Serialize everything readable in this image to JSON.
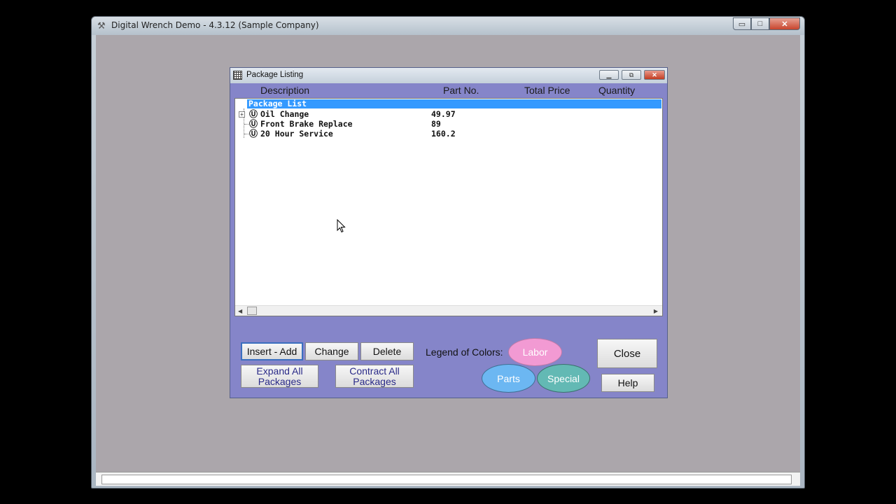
{
  "app": {
    "title": "Digital Wrench Demo - 4.3.12 (Sample Company)",
    "controls": {
      "minimize": "▭",
      "maximize": "□",
      "close": "✕"
    }
  },
  "dialog": {
    "title": "Package Listing",
    "columns": {
      "description": "Description",
      "part_no": "Part No.",
      "total_price": "Total Price",
      "quantity": "Quantity"
    },
    "tree": {
      "root_label": "Package List",
      "packages": [
        {
          "name": "Oil Change",
          "price": "49.97",
          "expandable": true
        },
        {
          "name": "Front Brake Replace",
          "price": "89",
          "expandable": false
        },
        {
          "name": "20 Hour Service",
          "price": "160.2",
          "expandable": false
        }
      ]
    },
    "buttons": {
      "insert_add": "Insert - Add",
      "change": "Change",
      "delete": "Delete",
      "expand_all": "Expand All Packages",
      "contract_all": "Contract All Packages",
      "close": "Close",
      "help": "Help"
    },
    "legend": {
      "label": "Legend of Colors:",
      "labor": "Labor",
      "parts": "Parts",
      "special": "Special"
    }
  },
  "colors": {
    "dialog_background": "#8585c9",
    "selection": "#3399ff",
    "labor": "#f29ad3",
    "parts": "#6cb7f2",
    "special": "#63b9b4",
    "workspace": "#aba6ab"
  }
}
